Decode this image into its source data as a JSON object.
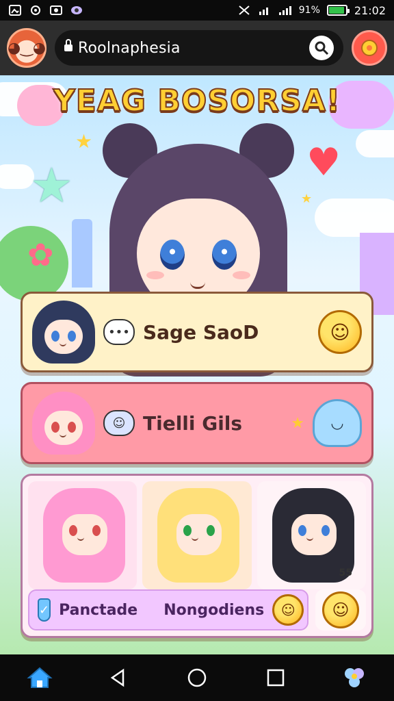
{
  "status_bar": {
    "battery_text": "91%",
    "battery_level": 0.91,
    "time": "21:02",
    "icons": [
      "image-icon",
      "sync-icon",
      "camera-icon",
      "app-icon",
      "mute-icon",
      "signal-icon",
      "wifi-icon",
      "battery-icon"
    ]
  },
  "browser": {
    "url": "Roolnaphesia",
    "avatar_icon": "avatar-icon",
    "search_icon": "search-icon",
    "menu_icon": "flower-icon"
  },
  "page": {
    "title": "YEAG BOSORSA!",
    "cards": [
      {
        "label": "Sage SaoD",
        "icons": [
          "chat-icon",
          "smiley-icon"
        ]
      },
      {
        "label": "Tielli Gils",
        "icons": [
          "chat-icon",
          "ghost-icon"
        ]
      }
    ],
    "card3": {
      "left_label": "Panctade",
      "right_label": "Nongodiens",
      "badge": "55"
    }
  },
  "bottom_nav": {
    "items": [
      "home-icon",
      "back-icon",
      "home-circle-icon",
      "recents-icon",
      "flower-icon"
    ]
  },
  "colors": {
    "accent": "#ff5a4c",
    "title_fill": "#ffcf33",
    "card1": "#fff2c8",
    "card2": "#ff9aa6",
    "card3": "#ffeef6"
  }
}
